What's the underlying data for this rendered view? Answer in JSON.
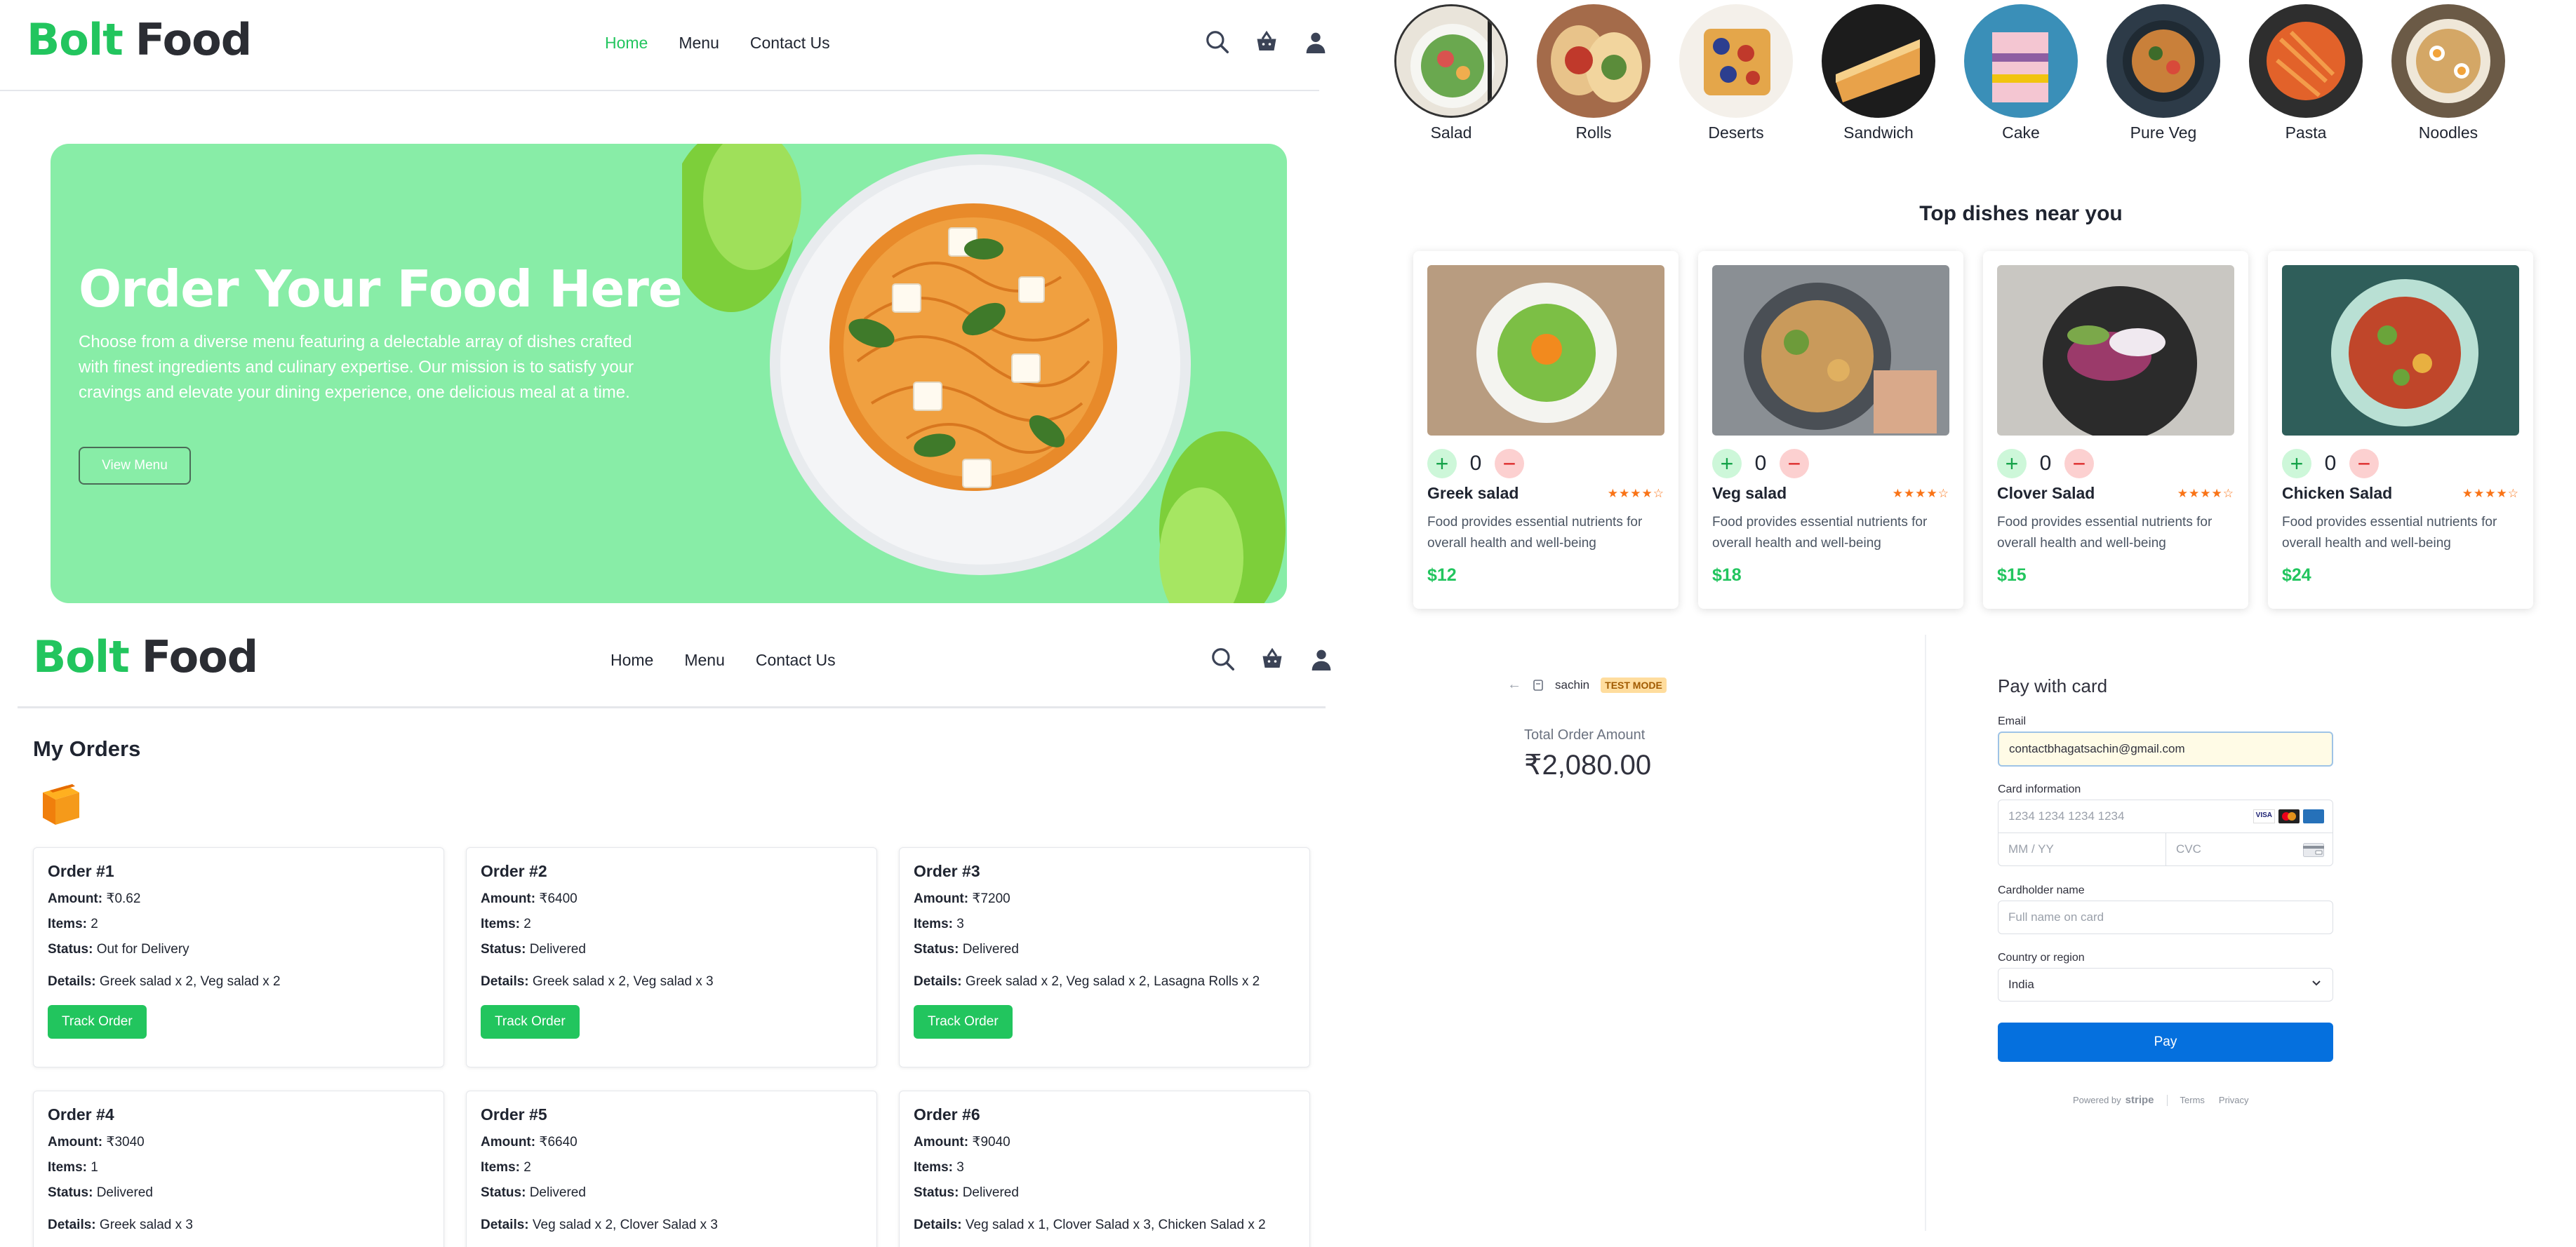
{
  "brand": {
    "name_part1": "Bolt",
    "name_part2": "Food"
  },
  "nav": {
    "home": "Home",
    "menu": "Menu",
    "contact": "Contact Us",
    "icons": [
      "search-icon",
      "basket-icon",
      "user-icon"
    ]
  },
  "hero": {
    "title": "Order Your Food Here",
    "body": "Choose from a diverse menu featuring a delectable array of dishes crafted with finest ingredients and culinary expertise. Our mission is to satisfy your cravings and elevate your dining experience, one delicious meal at a time.",
    "button": "View Menu"
  },
  "categories": [
    "Salad",
    "Rolls",
    "Deserts",
    "Sandwich",
    "Cake",
    "Pure Veg",
    "Pasta",
    "Noodles"
  ],
  "top_dishes": {
    "title": "Top dishes near you",
    "items": [
      {
        "name": "Greek salad",
        "qty": "0",
        "stars": "★★★★☆",
        "desc": "Food provides essential nutrients for overall health and well-being",
        "price": "$12"
      },
      {
        "name": "Veg salad",
        "qty": "0",
        "stars": "★★★★☆",
        "desc": "Food provides essential nutrients for overall health and well-being",
        "price": "$18"
      },
      {
        "name": "Clover Salad",
        "qty": "0",
        "stars": "★★★★☆",
        "desc": "Food provides essential nutrients for overall health and well-being",
        "price": "$15"
      },
      {
        "name": "Chicken Salad",
        "qty": "0",
        "stars": "★★★★☆",
        "desc": "Food provides essential nutrients for overall health and well-being",
        "price": "$24"
      }
    ]
  },
  "orders": {
    "title": "My Orders",
    "labels": {
      "amount": "Amount:",
      "items": "Items:",
      "status": "Status:",
      "details": "Details:"
    },
    "track_label": "Track Order",
    "list": [
      {
        "title": "Order #1",
        "amount": "₹0.62",
        "items": "2",
        "status": "Out for Delivery",
        "details": "Greek salad x 2, Veg salad x 2"
      },
      {
        "title": "Order #2",
        "amount": "₹6400",
        "items": "2",
        "status": "Delivered",
        "details": "Greek salad x 2, Veg salad x 3"
      },
      {
        "title": "Order #3",
        "amount": "₹7200",
        "items": "3",
        "status": "Delivered",
        "details": "Greek salad x 2, Veg salad x 2, Lasagna Rolls x 2"
      },
      {
        "title": "Order #4",
        "amount": "₹3040",
        "items": "1",
        "status": "Delivered",
        "details": "Greek salad x 3"
      },
      {
        "title": "Order #5",
        "amount": "₹6640",
        "items": "2",
        "status": "Delivered",
        "details": "Veg salad x 2, Clover Salad x 3"
      },
      {
        "title": "Order #6",
        "amount": "₹9040",
        "items": "3",
        "status": "Delivered",
        "details": "Veg salad x 1, Clover Salad x 3, Chicken Salad x 2"
      }
    ]
  },
  "checkout": {
    "merchant": "sachin",
    "test_mode": "TEST MODE",
    "total_label": "Total Order Amount",
    "total": "₹2,080.00",
    "pay_title": "Pay with card",
    "email_label": "Email",
    "email_value": "contactbhagatsachin@gmail.com",
    "card_label": "Card information",
    "card_placeholder": "1234 1234 1234 1234",
    "expiry_placeholder": "MM / YY",
    "cvc_placeholder": "CVC",
    "name_label": "Cardholder name",
    "name_placeholder": "Full name on card",
    "country_label": "Country or region",
    "country_value": "India",
    "pay_button": "Pay",
    "powered_by": "Powered by",
    "stripe": "stripe",
    "terms": "Terms",
    "privacy": "Privacy",
    "card_brands": [
      "VISA",
      "mastercard",
      "amex"
    ],
    "colors": {
      "pay": "#0570de",
      "email_bg": "#fffbe6"
    }
  },
  "colors": {
    "brand_green": "#22c55e",
    "hero_bg": "#88eda7"
  }
}
